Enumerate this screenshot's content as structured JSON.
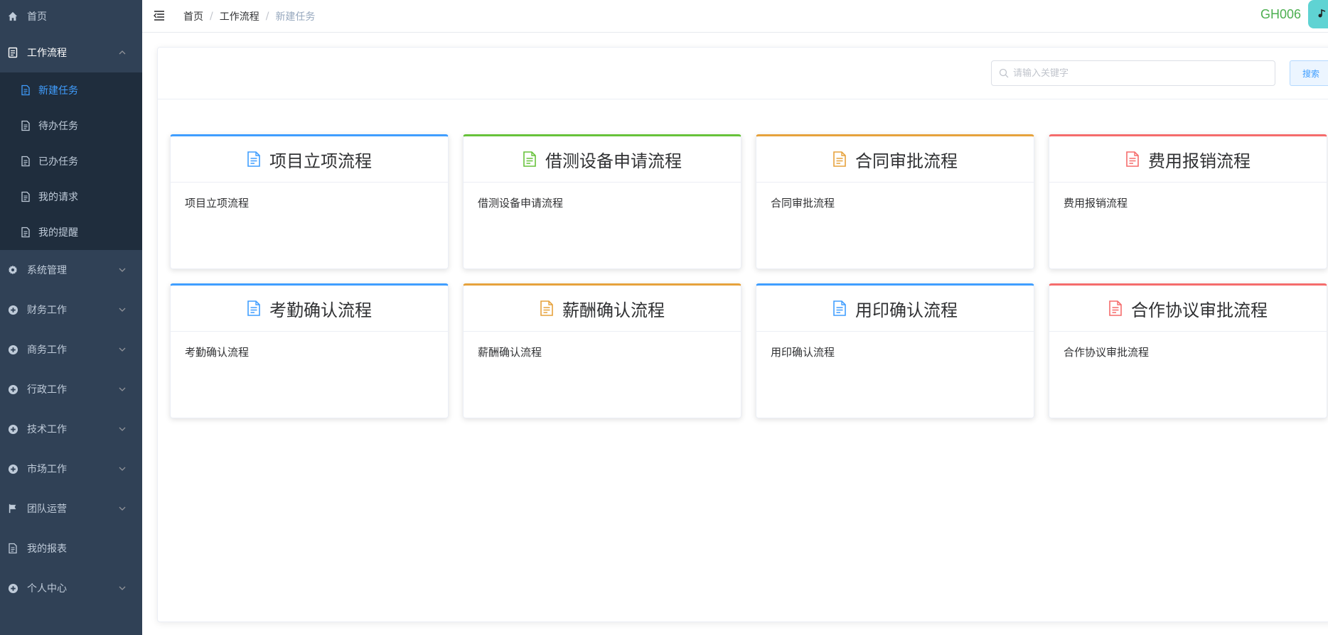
{
  "colors": {
    "sidebar_bg": "#304156",
    "submenu_bg": "#1f2d3d",
    "active": "#409EFF",
    "blue": "#409EFF",
    "green": "#67C23A",
    "orange": "#E6A23C",
    "red": "#F56C6C",
    "user_code": "#4CAF50"
  },
  "sidebar": {
    "items": [
      {
        "label": "首页",
        "icon": "home-icon"
      },
      {
        "label": "工作流程",
        "icon": "document-icon",
        "expanded": true,
        "children": [
          {
            "label": "新建任务",
            "icon": "document-icon",
            "active": true
          },
          {
            "label": "待办任务",
            "icon": "document-icon"
          },
          {
            "label": "已办任务",
            "icon": "document-icon"
          },
          {
            "label": "我的请求",
            "icon": "document-icon"
          },
          {
            "label": "我的提醒",
            "icon": "document-icon"
          }
        ]
      },
      {
        "label": "系统管理",
        "icon": "gear-icon"
      },
      {
        "label": "财务工作",
        "icon": "plus-circle-icon"
      },
      {
        "label": "商务工作",
        "icon": "plus-circle-icon"
      },
      {
        "label": "行政工作",
        "icon": "plus-circle-icon"
      },
      {
        "label": "技术工作",
        "icon": "plus-circle-icon"
      },
      {
        "label": "市场工作",
        "icon": "plus-circle-icon"
      },
      {
        "label": "团队运营",
        "icon": "flag-icon"
      },
      {
        "label": "我的报表",
        "icon": "document-icon"
      },
      {
        "label": "个人中心",
        "icon": "plus-circle-icon"
      }
    ]
  },
  "header": {
    "breadcrumb": [
      "首页",
      "工作流程",
      "新建任务"
    ],
    "user_code": "GH006"
  },
  "search": {
    "placeholder": "请输入关键字",
    "value": "",
    "button_label": "搜索"
  },
  "cards": [
    {
      "title": "项目立项流程",
      "desc": "项目立项流程",
      "color": "blue"
    },
    {
      "title": "借测设备申请流程",
      "desc": "借测设备申请流程",
      "color": "green"
    },
    {
      "title": "合同审批流程",
      "desc": "合同审批流程",
      "color": "orange"
    },
    {
      "title": "费用报销流程",
      "desc": "费用报销流程",
      "color": "red"
    },
    {
      "title": "考勤确认流程",
      "desc": "考勤确认流程",
      "color": "blue"
    },
    {
      "title": "薪酬确认流程",
      "desc": "薪酬确认流程",
      "color": "orange"
    },
    {
      "title": "用印确认流程",
      "desc": "用印确认流程",
      "color": "blue"
    },
    {
      "title": "合作协议审批流程",
      "desc": "合作协议审批流程",
      "color": "red"
    }
  ]
}
